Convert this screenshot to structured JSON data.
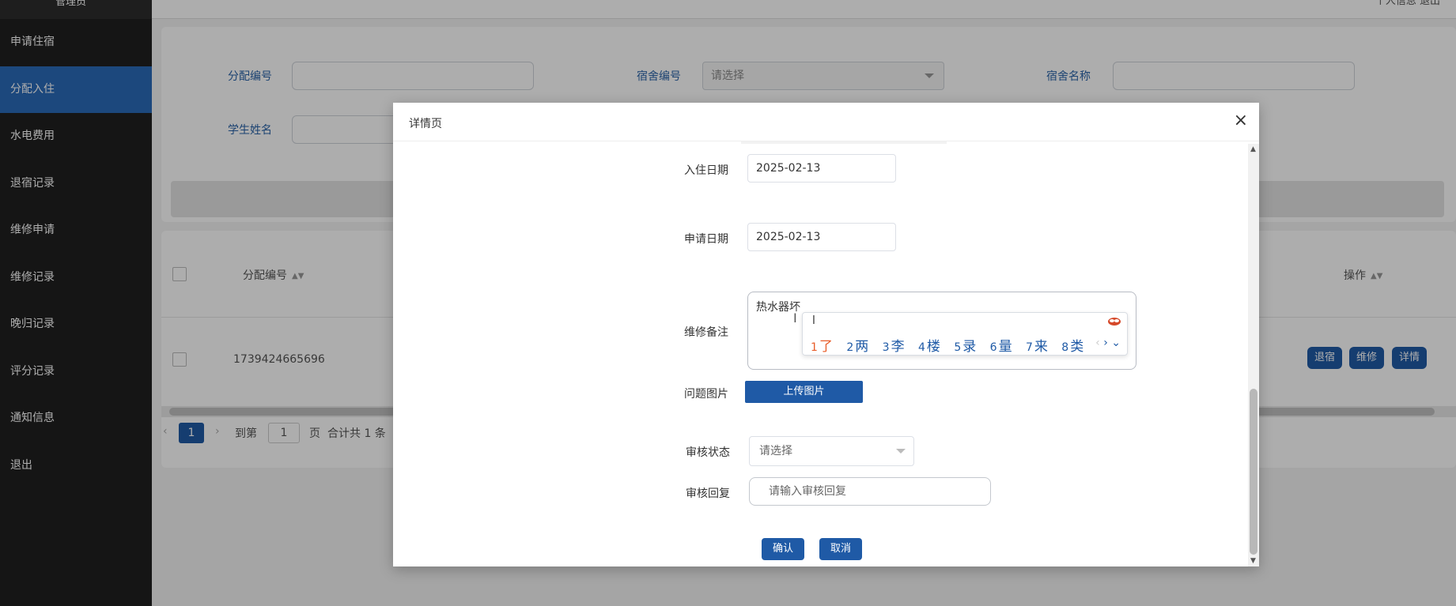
{
  "sidebar": {
    "top_label": "管理员",
    "items": [
      {
        "label": "申请住宿"
      },
      {
        "label": "分配入住"
      },
      {
        "label": "水电费用"
      },
      {
        "label": "退宿记录"
      },
      {
        "label": "维修申请"
      },
      {
        "label": "维修记录"
      },
      {
        "label": "晚归记录"
      },
      {
        "label": "评分记录"
      },
      {
        "label": "通知信息"
      },
      {
        "label": "退出"
      }
    ]
  },
  "topbar": {
    "right_text": "个人信息    退出"
  },
  "search": {
    "fields": [
      {
        "label": "分配编号",
        "value": ""
      },
      {
        "label": "宿舍编号",
        "placeholder": "请选择"
      },
      {
        "label": "宿舍名称",
        "value": ""
      },
      {
        "label": "学生姓名",
        "value": ""
      }
    ]
  },
  "table": {
    "headers": {
      "col1": "分配编号",
      "ops": "操作"
    },
    "rows": [
      {
        "id": "1739424665696"
      }
    ],
    "row_buttons": [
      "退宿",
      "维修",
      "详情"
    ]
  },
  "pager": {
    "current": "1",
    "goto_label": "到第",
    "goto_value": "1",
    "page_unit": "页",
    "total": "合计共 1 条"
  },
  "dialog": {
    "title": "详情页",
    "close": "×",
    "fields": {
      "checkin_label": "入住日期",
      "checkin_value": "2025-02-13",
      "apply_label": "申请日期",
      "apply_value": "2025-02-13",
      "remark_label": "维修备注",
      "remark_value": "热水器坏",
      "photo_label": "问题图片",
      "upload_button": "上传图片",
      "status_label": "审核状态",
      "status_placeholder": "请选择",
      "reply_label": "审核回复",
      "reply_placeholder": "请输入审核回复"
    },
    "confirm": "确认",
    "cancel": "取消"
  },
  "ime": {
    "input": "l",
    "candidates": [
      {
        "n": "1",
        "text": "了"
      },
      {
        "n": "2",
        "text": "两"
      },
      {
        "n": "3",
        "text": "李"
      },
      {
        "n": "4",
        "text": "楼"
      },
      {
        "n": "5",
        "text": "录"
      },
      {
        "n": "6",
        "text": "量"
      },
      {
        "n": "7",
        "text": "来"
      },
      {
        "n": "8",
        "text": "类"
      }
    ]
  },
  "colors": {
    "primary": "#1f5aa6",
    "sidebar": "#1f1f1f",
    "active": "#2a6ab8",
    "label": "#2a63a8"
  }
}
